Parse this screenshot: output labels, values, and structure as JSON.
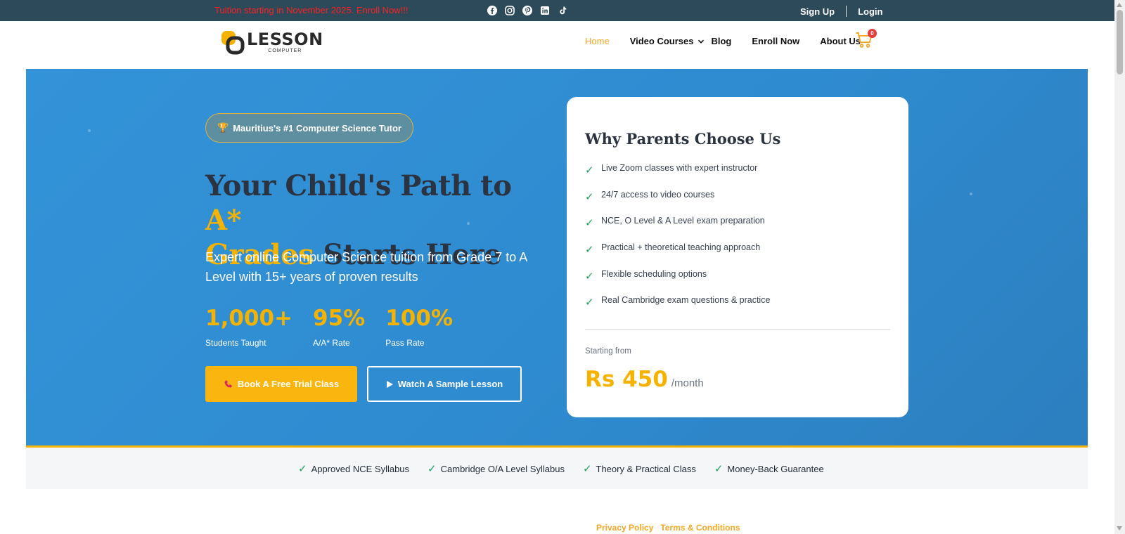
{
  "topbar": {
    "promo": "Tuition starting in November 2025. Enroll Now!!!",
    "socials": [
      "facebook-icon",
      "instagram-icon",
      "pinterest-icon",
      "linkedin-icon",
      "tiktok-icon"
    ],
    "signup_label": "Sign Up",
    "login_label": "Login"
  },
  "header": {
    "logo_text": "LESSON",
    "logo_subtext": "COMPUTER",
    "nav": [
      {
        "label": "Home",
        "active": true
      },
      {
        "label": "Video Courses",
        "has_dropdown": true
      },
      {
        "label": "Blog"
      },
      {
        "label": "Enroll Now"
      },
      {
        "label": "About Us"
      }
    ],
    "cart_count": "0"
  },
  "hero": {
    "badge": "Mauritius's #1 Computer Science Tutor",
    "title_part1": "Your Child's Path to ",
    "title_highlight1": "A*",
    "title_highlight2": "Grades",
    "title_part2": " Starts Here",
    "subtitle": "Expert online Computer Science tuition from Grade 7 to A Level with 15+ years of proven results",
    "stats": [
      {
        "value": "1,000+",
        "label": "Students Taught"
      },
      {
        "value": "95%",
        "label": "A/A* Rate"
      },
      {
        "value": "100%",
        "label": "Pass Rate"
      }
    ],
    "primary_button": "Book A Free Trial Class",
    "secondary_button": "Watch A Sample Lesson"
  },
  "card": {
    "title": "Why Parents Choose Us",
    "features": [
      "Live Zoom classes with expert instructor",
      "24/7 access to video courses",
      "NCE, O Level & A Level exam preparation",
      "Practical + theoretical teaching approach",
      "Flexible scheduling options",
      "Real Cambridge exam questions & practice"
    ],
    "starting_from": "Starting from",
    "price": "Rs 450",
    "per": "/month"
  },
  "trust_strip": [
    "Approved NCE Syllabus",
    "Cambridge O/A Level Syllabus",
    "Theory & Practical Class",
    "Money-Back Guarantee"
  ],
  "footer": {
    "privacy": "Privacy Policy",
    "terms": "Terms & Conditions"
  },
  "colors": {
    "accent": "#f5b300",
    "hero_blue": "#3393d8",
    "topbar": "#2c4a5a",
    "check_green": "#21a05c",
    "promo_red": "#ff1f1f"
  }
}
